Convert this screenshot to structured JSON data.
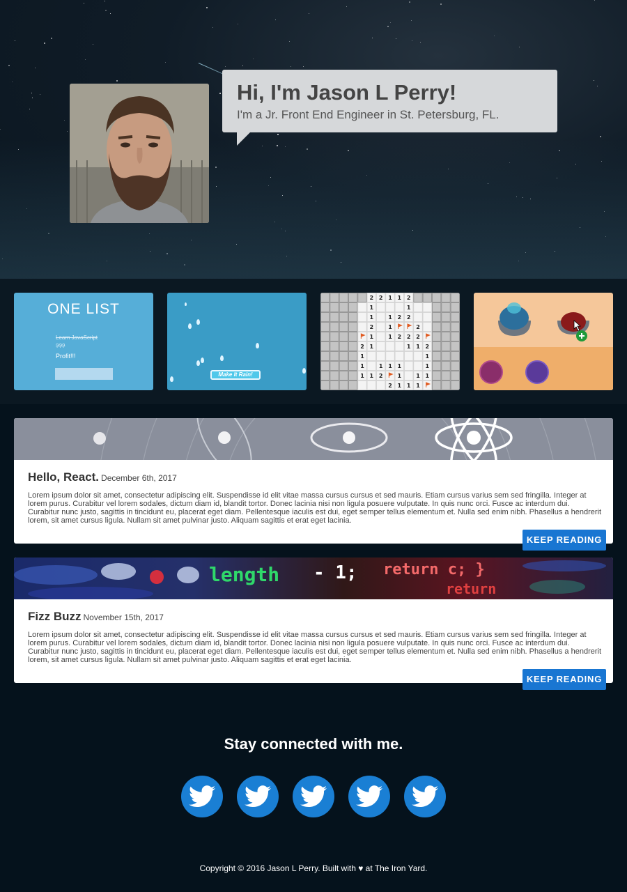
{
  "hero": {
    "title": "Hi, I'm Jason L Perry!",
    "subtitle": "I'm a Jr. Front End Engineer in St. Petersburg, FL."
  },
  "projects": [
    {
      "name": "ONE LIST",
      "items": [
        "Learn JavaScript",
        "???",
        "Profit!!!"
      ]
    },
    {
      "button": "Make It Rain!"
    },
    {
      "grid": [
        [
          "",
          "",
          "",
          "",
          "",
          "2",
          "2",
          "1",
          "1",
          "2",
          "",
          "",
          "",
          "",
          ""
        ],
        [
          "",
          "",
          "",
          "",
          "",
          "1",
          "",
          "",
          "",
          "1",
          "",
          "",
          "",
          "",
          ""
        ],
        [
          "",
          "",
          "",
          "",
          "",
          "1",
          "",
          "1",
          "2",
          "2",
          "",
          "",
          "",
          "",
          ""
        ],
        [
          "",
          "",
          "",
          "",
          "",
          "2",
          "",
          "1",
          "F",
          "F",
          "2",
          "",
          "",
          "",
          ""
        ],
        [
          "",
          "",
          "",
          "",
          "F",
          "1",
          "",
          "1",
          "2",
          "2",
          "2",
          "F",
          "",
          "",
          ""
        ],
        [
          "",
          "",
          "",
          "",
          "2",
          "1",
          "",
          "",
          "",
          "1",
          "1",
          "2",
          "",
          "",
          ""
        ],
        [
          "",
          "",
          "",
          "",
          "1",
          "",
          "",
          "",
          "",
          "",
          "",
          "1",
          "",
          "",
          ""
        ],
        [
          "",
          "",
          "",
          "",
          "1",
          "",
          "1",
          "1",
          "1",
          "",
          "",
          "1",
          "",
          "",
          ""
        ],
        [
          "",
          "",
          "",
          "",
          "1",
          "1",
          "2",
          "F",
          "1",
          "",
          "1",
          "1",
          "",
          "",
          ""
        ],
        [
          "",
          "",
          "",
          "",
          "",
          "",
          "",
          "2",
          "1",
          "1",
          "1",
          "F",
          "",
          "",
          ""
        ]
      ]
    },
    {}
  ],
  "posts": [
    {
      "title": "Hello, React.",
      "date": "December 6th, 2017",
      "body": "Lorem ipsum dolor sit amet, consectetur adipiscing elit. Suspendisse id elit vitae massa cursus cursus et sed mauris. Etiam cursus varius sem sed fringilla. Integer at lorem purus. Curabitur vel lorem sodales, dictum diam id, blandit tortor. Donec lacinia nisi non ligula posuere vulputate. In quis nunc orci. Fusce ac interdum dui. Curabitur nunc justo, sagittis in tincidunt eu, placerat eget diam. Pellentesque iaculis est dui, eget semper tellus elementum et. Nulla sed enim nibh. Phasellus a hendrerit lorem, sit amet cursus ligula. Nullam sit amet pulvinar justo. Aliquam sagittis et erat eget lacinia.",
      "button": "KEEP READING"
    },
    {
      "title": "Fizz Buzz",
      "date": "November 15th, 2017",
      "body": "Lorem ipsum dolor sit amet, consectetur adipiscing elit. Suspendisse id elit vitae massa cursus cursus et sed mauris. Etiam cursus varius sem sed fringilla. Integer at lorem purus. Curabitur vel lorem sodales, dictum diam id, blandit tortor. Donec lacinia nisi non ligula posuere vulputate. In quis nunc orci. Fusce ac interdum dui. Curabitur nunc justo, sagittis in tincidunt eu, placerat eget diam. Pellentesque iaculis est dui, eget semper tellus elementum et. Nulla sed enim nibh. Phasellus a hendrerit lorem, sit amet cursus ligula. Nullam sit amet pulvinar justo. Aliquam sagittis et erat eget lacinia.",
      "button": "KEEP READING",
      "banner_code": [
        "length",
        "- 1;",
        "return c; }",
        "return"
      ]
    }
  ],
  "footer": {
    "connect_title": "Stay connected with me.",
    "social_icons": [
      "twitter-icon",
      "twitter-icon",
      "twitter-icon",
      "twitter-icon",
      "twitter-icon"
    ],
    "copyright": "Copyright © 2016 Jason L Perry. Built with ♥ at The Iron Yard."
  },
  "colors": {
    "accent": "#1976d2",
    "social": "#1a7fd4",
    "page_bg": "#05121c",
    "bubble_bg": "#d6d8da"
  }
}
